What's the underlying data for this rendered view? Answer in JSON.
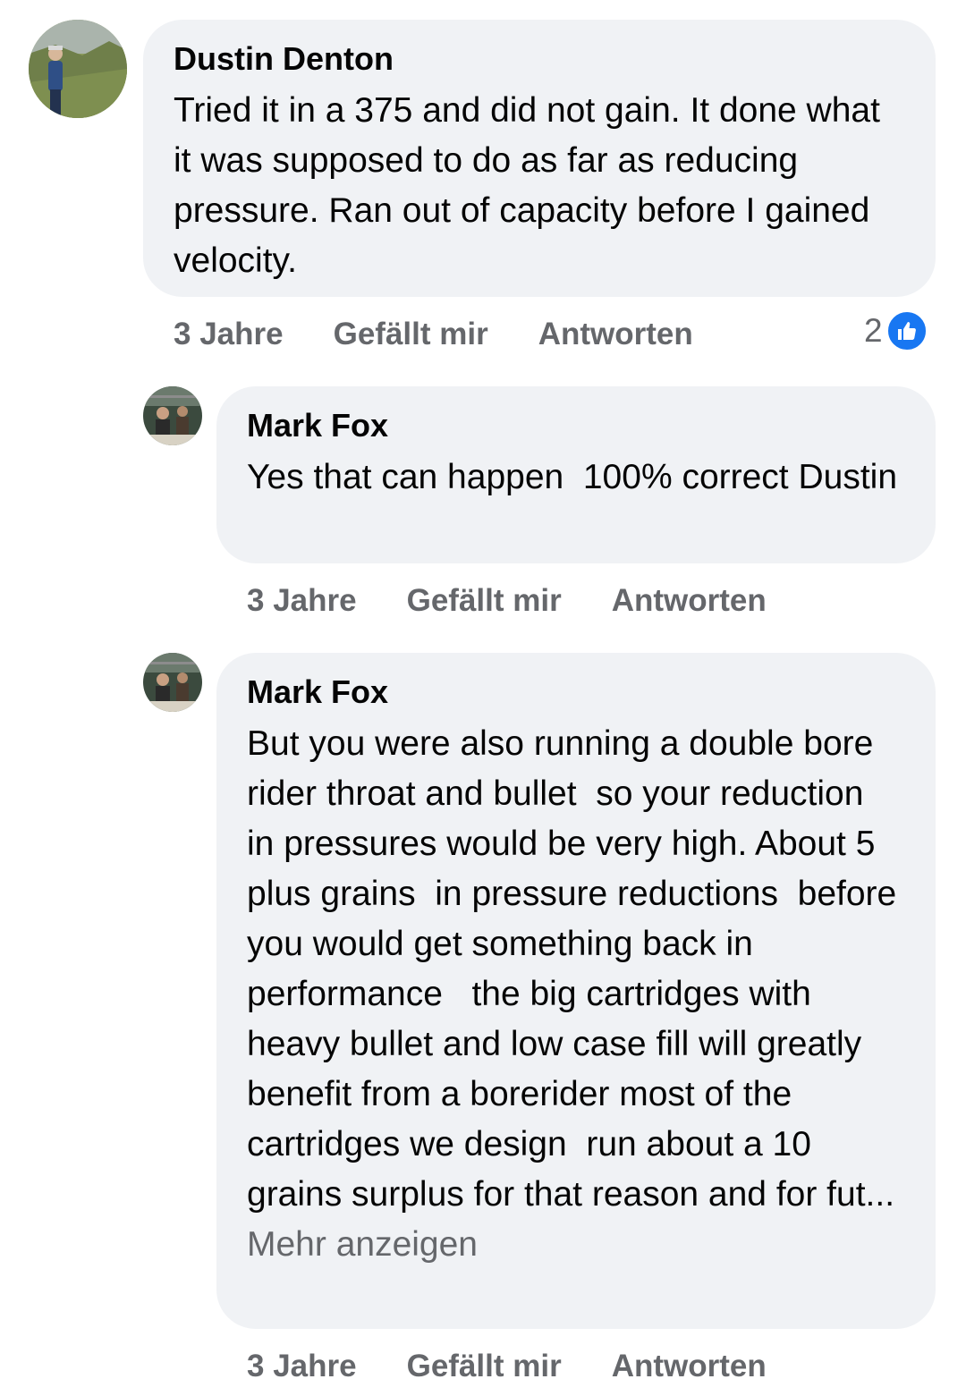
{
  "comments": [
    {
      "author": "Dustin Denton",
      "text": "Tried it in a 375 and did not gain. It done what it was supposed to do as far as reducing pressure. Ran out of capacity before I gained velocity.",
      "time": "3 Jahre",
      "like_label": "Gefällt mir",
      "reply_label": "Antworten",
      "reaction_count": "2",
      "reaction_icon": "like-icon"
    },
    {
      "author": "Mark Fox",
      "text": "Yes that can happen  100% correct Dustin",
      "time": "3 Jahre",
      "like_label": "Gefällt mir",
      "reply_label": "Antworten"
    },
    {
      "author": "Mark Fox",
      "text": "But you were also running a double bore rider throat and bullet  so your reduction  in pressures would be very high. About 5 plus grains  in pressure reductions  before you would get something back in performance   the big cartridges with heavy bullet and low case fill will greatly benefit from a borerider most of the cartridges we design  run about a 10 grains surplus for that reason and for fut...",
      "more_label": "Mehr anzeigen",
      "time": "3 Jahre",
      "like_label": "Gefällt mir",
      "reply_label": "Antworten"
    }
  ],
  "colors": {
    "bubble": "#f0f2f5",
    "text": "#050505",
    "secondary": "#65676b",
    "like_badge": "#1877f2"
  }
}
